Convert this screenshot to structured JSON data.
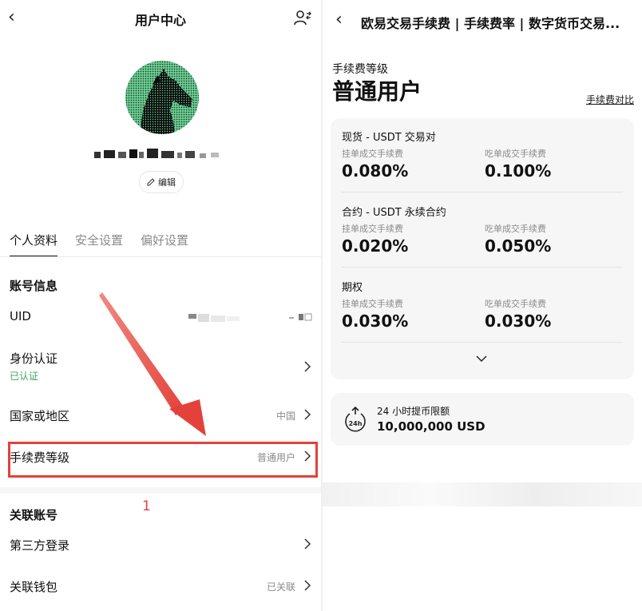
{
  "left": {
    "header": {
      "title": "用户中心",
      "back_icon": "chevron-left-icon",
      "switch_icon": "user-switch-icon"
    },
    "profile": {
      "edit_label": "编辑"
    },
    "tabs": [
      "个人资料",
      "安全设置",
      "偏好设置"
    ],
    "account_section": "账号信息",
    "rows": {
      "uid": {
        "label": "UID"
      },
      "identity": {
        "label": "身份认证",
        "status": "已认证"
      },
      "region": {
        "label": "国家或地区",
        "value": "中国"
      },
      "fee_level": {
        "label": "手续费等级",
        "value": "普通用户"
      }
    },
    "linked_section": "关联账号",
    "linked_rows": {
      "third_party": {
        "label": "第三方登录"
      },
      "wallet": {
        "label": "关联钱包",
        "value": "已关联"
      }
    },
    "annotation": "1",
    "accent_color": "#e3423a",
    "verified_color": "#3aa55c"
  },
  "right": {
    "header": {
      "title": "欧易交易手续费 | 手续费率 | 数字货币交易..."
    },
    "fee_caption": "手续费等级",
    "fee_level": "普通用户",
    "compare_link": "手续费对比",
    "groups": [
      {
        "title": "现货 - USDT 交易对",
        "maker_label": "挂单成交手续费",
        "maker": "0.080%",
        "taker_label": "吃单成交手续费",
        "taker": "0.100%"
      },
      {
        "title": "合约 - USDT 永续合约",
        "maker_label": "挂单成交手续费",
        "maker": "0.020%",
        "taker_label": "吃单成交手续费",
        "taker": "0.050%"
      },
      {
        "title": "期权",
        "maker_label": "挂单成交手续费",
        "maker": "0.030%",
        "taker_label": "吃单成交手续费",
        "taker": "0.030%"
      }
    ],
    "withdraw": {
      "label": "24 小时提币限额",
      "value": "10,000,000 USD",
      "icon_text": "24h"
    }
  }
}
